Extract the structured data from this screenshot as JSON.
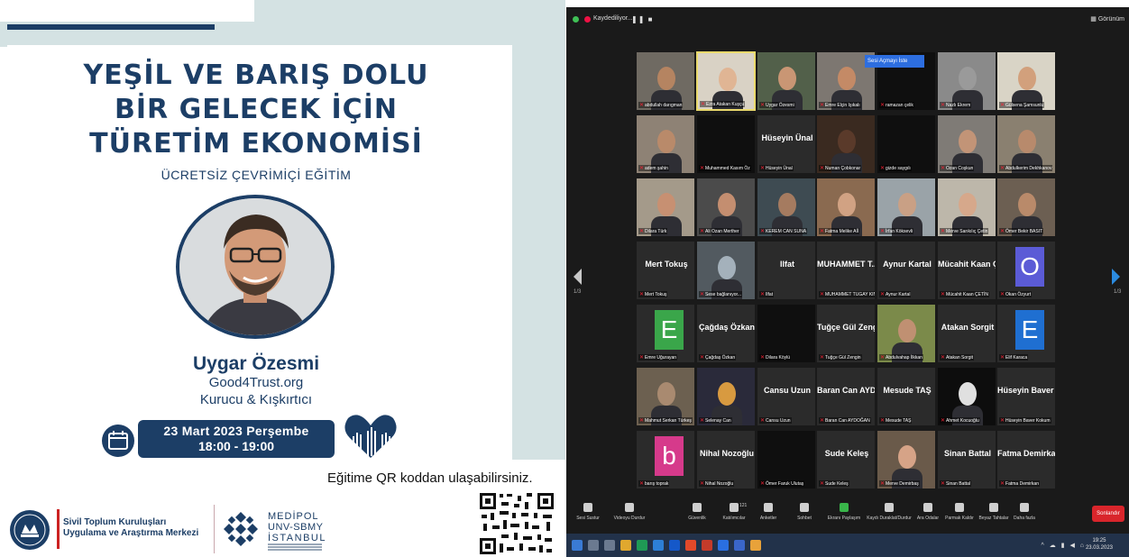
{
  "poster": {
    "title_lines": [
      "YEŞİL VE BARIŞ DOLU",
      "BİR GELECEK İÇİN",
      "TÜRETİM EKONOMİSİ"
    ],
    "subtitle": "ÜCRETSİZ ÇEVRİMİÇİ EĞİTİM",
    "speaker_name": "Uygar Özesmi",
    "speaker_org": "Good4Trust.org",
    "speaker_role": "Kurucu & Kışkırtıcı",
    "date": "23 Mart 2023 Perşembe",
    "time": "18:00 - 19:00",
    "qr_text": "Eğitime QR koddan ulaşabilirsiniz.",
    "stk_line1": "Sivil Toplum Kuruluşları",
    "stk_line2": "Uygulama ve Araştırma Merkezi",
    "medipol_line1": "MEDİPOL",
    "medipol_line2": "UNV-SBMY",
    "medipol_line3": "İSTANBUL",
    "brand_color": "#1c3e66"
  },
  "zoom": {
    "recording_label": "Kaydediliyor...",
    "view_label": "Görünüm",
    "unmute_popup": "Sesi Açmayı İste",
    "nav_left_page": "1/3",
    "nav_right_page": "1/3",
    "tiles": [
      {
        "label": "abdullah darıgman",
        "type": "video",
        "skin": "#b58461",
        "bg": "#6f6a62",
        "row": 0,
        "col": 0
      },
      {
        "label": "Ezra Atakan Kuşçu",
        "type": "video",
        "skin": "#e0b594",
        "bg": "#d9d2c5",
        "row": 0,
        "col": 1,
        "active": true
      },
      {
        "label": "Uygar Özesmi",
        "type": "video",
        "skin": "#c99674",
        "bg": "#52604a",
        "row": 0,
        "col": 2
      },
      {
        "label": "Emre Elçin Işıkalı",
        "type": "video",
        "skin": "#c48a66",
        "bg": "#7d7771",
        "row": 0,
        "col": 3
      },
      {
        "label": "ramazan çelik",
        "type": "dark",
        "row": 0,
        "col": 4
      },
      {
        "label": "Nazlı Ekrem",
        "type": "video",
        "skin": "#9a9a9a",
        "bg": "#8a8a8a",
        "row": 0,
        "col": 5
      },
      {
        "label": "Gülsena Şamsunlu",
        "type": "video",
        "skin": "#d2a07c",
        "bg": "#d9d4c6",
        "row": 0,
        "col": 6
      },
      {
        "label": "adem şahin",
        "type": "video",
        "skin": "#b98a6a",
        "bg": "#8e8275",
        "row": 1,
        "col": 0
      },
      {
        "label": "Muhammed Kasım Öz",
        "type": "dark",
        "row": 1,
        "col": 1
      },
      {
        "label": "Hüseyin Ünal",
        "name": "Hüseyin Ünal",
        "type": "name",
        "row": 1,
        "col": 2
      },
      {
        "label": "Numan Çobkonar",
        "type": "video",
        "skin": "#5a3a2a",
        "bg": "#3a2a20",
        "row": 1,
        "col": 3
      },
      {
        "label": "gizde saygılı",
        "type": "dark",
        "row": 1,
        "col": 4
      },
      {
        "label": "Ozan Coşkun",
        "type": "video",
        "skin": "#c29477",
        "bg": "#7f7b76",
        "row": 1,
        "col": 5
      },
      {
        "label": "Abdulkerim Dekhkanov",
        "type": "video",
        "skin": "#b88a6c",
        "bg": "#8a8070",
        "row": 1,
        "col": 6
      },
      {
        "label": "Dilara Türk",
        "type": "video",
        "skin": "#c79072",
        "bg": "#a49a8a",
        "row": 2,
        "col": 0
      },
      {
        "label": "Ali Ozan Merther",
        "type": "video",
        "skin": "#c48e70",
        "bg": "#4b4b4b",
        "row": 2,
        "col": 1
      },
      {
        "label": "KEREM CAN SUNA",
        "type": "video",
        "skin": "#a57b60",
        "bg": "#3e4b52",
        "row": 2,
        "col": 2
      },
      {
        "label": "Fatma Melike Aİİ",
        "type": "video",
        "skin": "#d1a283",
        "bg": "#8a6a50",
        "row": 2,
        "col": 3
      },
      {
        "label": "İrfan Köksevli",
        "type": "video",
        "skin": "#c9a085",
        "bg": "#9aa3a8",
        "row": 2,
        "col": 4
      },
      {
        "label": "Merve Sarıkılıç Çetin",
        "type": "video",
        "skin": "#d6a88b",
        "bg": "#bdb7aa",
        "row": 2,
        "col": 5
      },
      {
        "label": "Ömer Bekir BASIT",
        "type": "video",
        "skin": "#b98a6a",
        "bg": "#6c5f52",
        "row": 2,
        "col": 6
      },
      {
        "label": "Mert Tokuş",
        "name": "Mert Tokuş",
        "type": "name",
        "row": 3,
        "col": 0
      },
      {
        "label": "Sese bağlanıyor...",
        "type": "video",
        "skin": "#a4b1bb",
        "bg": "#525a60",
        "row": 3,
        "col": 1
      },
      {
        "label": "Ilfat",
        "name": "Ilfat",
        "type": "name",
        "row": 3,
        "col": 2
      },
      {
        "label": "MUHAMMET TUGAY KINAŞ",
        "name": "MUHAMMET T...",
        "type": "name",
        "row": 3,
        "col": 3
      },
      {
        "label": "Aynur Kartal",
        "name": "Aynur Kartal",
        "type": "name",
        "row": 3,
        "col": 4
      },
      {
        "label": "Mücahit Kaan ÇETİN",
        "name": "Mücahit Kaan Ç...",
        "type": "name",
        "row": 3,
        "col": 5
      },
      {
        "label": "Okan Özyurt",
        "type": "letter",
        "letter": "O",
        "color": "#5b5bd6",
        "row": 3,
        "col": 6
      },
      {
        "label": "Emre Uğurayan",
        "type": "letter",
        "letter": "E",
        "color": "#3aa64a",
        "row": 4,
        "col": 0
      },
      {
        "label": "Çağdaş Özkan",
        "name": "Çağdaş Özkan",
        "type": "name",
        "row": 4,
        "col": 1
      },
      {
        "label": "Dilara Köylü",
        "type": "dark",
        "row": 4,
        "col": 2
      },
      {
        "label": "Tuğçe Gül Zengin",
        "name": "Tuğçe Gül Zengin",
        "type": "name",
        "row": 4,
        "col": 3
      },
      {
        "label": "Abdulvahap İlkkan",
        "type": "video",
        "skin": "#c09072",
        "bg": "#7b8a4a",
        "row": 4,
        "col": 4
      },
      {
        "label": "Atakan Sorgit",
        "name": "Atakan Sorgit",
        "type": "name",
        "row": 4,
        "col": 5
      },
      {
        "label": "Elif Karaca",
        "type": "letter",
        "letter": "E",
        "color": "#1f6fd1",
        "row": 4,
        "col": 6
      },
      {
        "label": "Mahmut Serkan Türkeş",
        "type": "video",
        "skin": "#a98a70",
        "bg": "#6c6050",
        "row": 5,
        "col": 0
      },
      {
        "label": "Selenay Can",
        "type": "video",
        "skin": "#d89a40",
        "bg": "#2a2a3a",
        "row": 5,
        "col": 1
      },
      {
        "label": "Cansu Uzun",
        "name": "Cansu Uzun",
        "type": "name",
        "row": 5,
        "col": 2
      },
      {
        "label": "Baran Can AYDOĞAN",
        "name": "Baran Can AYD...",
        "type": "name",
        "row": 5,
        "col": 3
      },
      {
        "label": "Mesude TAŞ",
        "name": "Mesude TAŞ",
        "type": "name",
        "row": 5,
        "col": 4
      },
      {
        "label": "Ahmet Kocuoğlu",
        "type": "video",
        "skin": "#e0e0e0",
        "bg": "#0d0d0d",
        "row": 5,
        "col": 5
      },
      {
        "label": "Hüseyin Baver Kokum",
        "name": "Hüseyin Baver K...",
        "type": "name",
        "row": 5,
        "col": 6
      },
      {
        "label": "barış toprak",
        "type": "letter",
        "letter": "b",
        "color": "#d63a8b",
        "row": 6,
        "col": 0
      },
      {
        "label": "Nihal Nozoğlu",
        "name": "Nihal Nozoğlu",
        "type": "name",
        "row": 6,
        "col": 1
      },
      {
        "label": "Ömer Faruk Ulutaş",
        "type": "dark",
        "row": 6,
        "col": 2
      },
      {
        "label": "Sude Keleş",
        "name": "Sude Keleş",
        "type": "name",
        "row": 6,
        "col": 3
      },
      {
        "label": "Merve Demirbaş",
        "type": "video",
        "skin": "#d6a387",
        "bg": "#6a5a4a",
        "row": 6,
        "col": 4
      },
      {
        "label": "Sinan Battal",
        "name": "Sinan Battal",
        "type": "name",
        "row": 6,
        "col": 5
      },
      {
        "label": "Fatma Demirkan",
        "name": "Fatma Demirkan",
        "type": "name",
        "row": 6,
        "col": 6
      }
    ],
    "toolbar": [
      {
        "label": "Sesi Sustur",
        "icon": "microphone-icon"
      },
      {
        "label": "Videoyu Durdur",
        "icon": "video-camera-icon"
      },
      {
        "label": "Güvenlik",
        "icon": "shield-icon"
      },
      {
        "label": "Katılımcılar",
        "icon": "participants-icon",
        "count": "121"
      },
      {
        "label": "Anketler",
        "icon": "poll-icon"
      },
      {
        "label": "Sohbet",
        "icon": "chat-icon"
      },
      {
        "label": "Ekranı Paylaşım",
        "icon": "share-screen-icon",
        "green": true
      },
      {
        "label": "Kaydı Duraklat/Durdur",
        "icon": "record-icon"
      },
      {
        "label": "Ara Odalar",
        "icon": "breakout-rooms-icon"
      },
      {
        "label": "Parmak Kaldır",
        "icon": "raise-hand-icon"
      },
      {
        "label": "Beyaz Tahtalar",
        "icon": "whiteboard-icon"
      },
      {
        "label": "Daha fazla",
        "icon": "more-icon"
      }
    ],
    "end_button": "Sonlandır",
    "clock_time": "19:25",
    "clock_date": "23.03.2023"
  }
}
